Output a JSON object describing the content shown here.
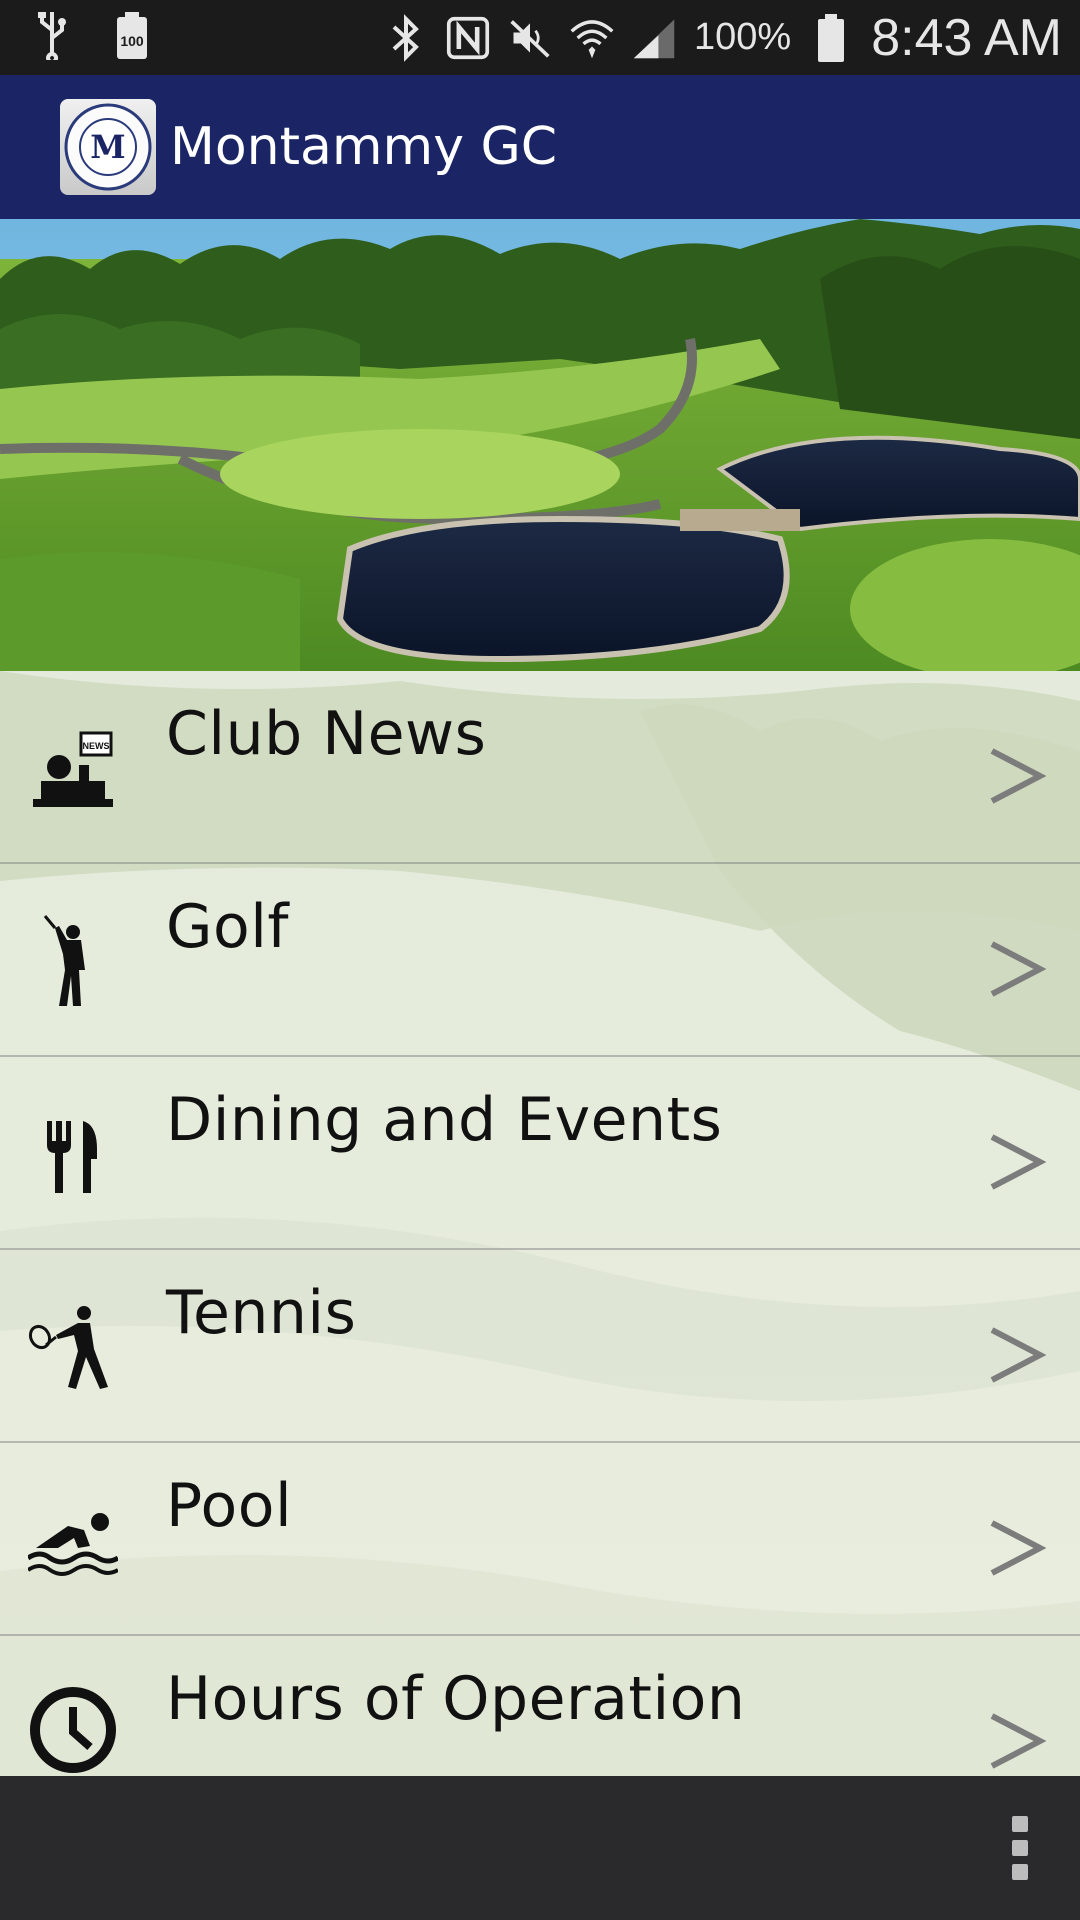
{
  "status_bar": {
    "battery_box_label": "100",
    "battery_percent": "100%",
    "time": "8:43 AM",
    "icons": [
      "usb-icon",
      "battery-saver-icon",
      "bluetooth-icon",
      "nfc-icon",
      "mute-icon",
      "wifi-icon",
      "signal-icon",
      "battery-icon"
    ]
  },
  "app_bar": {
    "title": "Montammy GC",
    "logo_letter": "M",
    "logo_ring_text": "MONTAMMY GOLF CLUB",
    "logo_ring_text_bottom": "ALPINE, N.J."
  },
  "menu": {
    "items": [
      {
        "label": "Club News",
        "icon": "news-icon"
      },
      {
        "label": "Golf",
        "icon": "golfer-icon"
      },
      {
        "label": "Dining and Events",
        "icon": "fork-knife-icon"
      },
      {
        "label": "Tennis",
        "icon": "tennis-player-icon"
      },
      {
        "label": "Pool",
        "icon": "swimmer-icon"
      },
      {
        "label": "Hours of Operation",
        "icon": "clock-icon"
      }
    ],
    "chevron": ">"
  },
  "colors": {
    "app_bar": "#1b2566",
    "status_bar": "#1b1b1b",
    "bottom_bar": "#2a2a2c"
  }
}
